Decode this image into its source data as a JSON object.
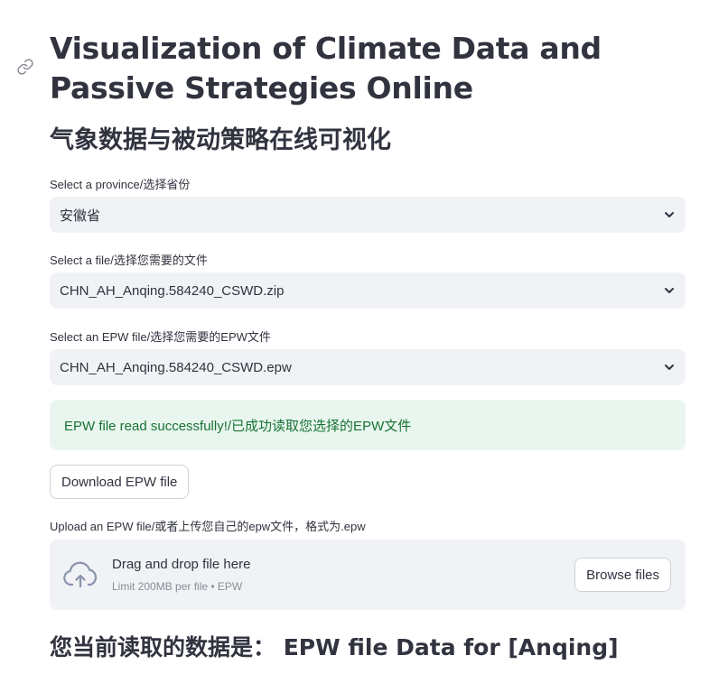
{
  "page": {
    "title": "Visualization of Climate Data and Passive Strategies Online",
    "subtitle": "气象数据与被动策略在线可视化"
  },
  "province": {
    "label": "Select a province/选择省份",
    "value": "安徽省"
  },
  "file": {
    "label": "Select a file/选择您需要的文件",
    "value": "CHN_AH_Anqing.584240_CSWD.zip"
  },
  "epw": {
    "label": "Select an EPW file/选择您需要的EPW文件",
    "value": "CHN_AH_Anqing.584240_CSWD.epw"
  },
  "alert": {
    "text": "EPW file read successfully!/已成功读取您选择的EPW文件",
    "color": "#177233",
    "background": "#e9f6ef"
  },
  "download": {
    "label": "Download EPW file"
  },
  "upload": {
    "label": "Upload an EPW file/或者上传您自己的epw文件，格式为.epw",
    "drop_text": "Drag and drop file here",
    "hint": "Limit 200MB per file • EPW",
    "browse_label": "Browse files"
  },
  "current": {
    "heading": "您当前读取的数据是：  EPW file Data for [Anqing]"
  },
  "icons": {
    "anchor": "link-icon",
    "select": "chevron-down-icon",
    "upload": "cloud-upload-icon"
  }
}
